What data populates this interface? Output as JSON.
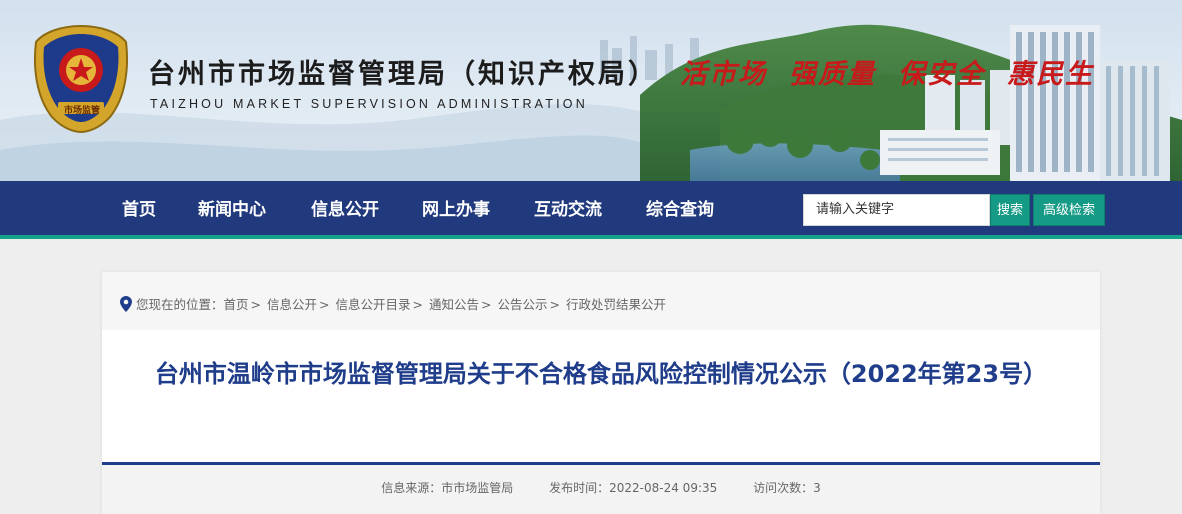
{
  "header": {
    "title_cn": "台州市市场监督管理局（知识产权局）",
    "title_en": "TAIZHOU MARKET SUPERVISION ADMINISTRATION",
    "emblem_text": "市场监管",
    "slogans": [
      "活市场",
      "强质量",
      "保安全",
      "惠民生"
    ]
  },
  "nav": {
    "items": [
      "首页",
      "新闻中心",
      "信息公开",
      "网上办事",
      "互动交流",
      "综合查询"
    ],
    "search_placeholder": "请输入关键字",
    "search_label": "搜索",
    "advanced_label": "高级检索"
  },
  "breadcrumb": {
    "prefix": "您现在的位置：",
    "items": [
      "首页",
      "信息公开",
      "信息公开目录",
      "通知公告",
      "公告公示",
      "行政处罚结果公开"
    ]
  },
  "article": {
    "title": "台州市温岭市市场监督管理局关于不合格食品风险控制情况公示（2022年第23号）",
    "source_label": "信息来源：",
    "source": "市市场监管局",
    "time_label": "发布时间：",
    "time": "2022-08-24 09:35",
    "views_label": "访问次数：",
    "views": "3"
  },
  "colors": {
    "nav_bg": "#213a7d",
    "nav_accent": "#16a38a",
    "button_bg": "#159a86",
    "title_blue": "#1f3d8a",
    "slogan_red": "#c8191b"
  }
}
